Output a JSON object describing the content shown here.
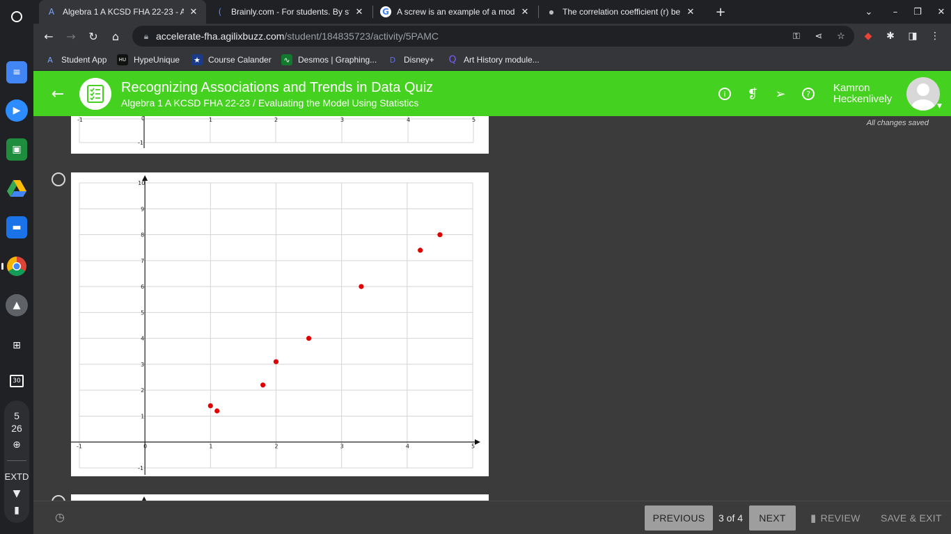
{
  "shelf": {
    "status_day": "5",
    "status_num": "26",
    "status_ext": "EXTD"
  },
  "tabs": [
    {
      "label": "Algebra 1 A KCSD FHA 22-23 - A"
    },
    {
      "label": "Brainly.com - For students. By st"
    },
    {
      "label": "A screw is an example of a mod"
    },
    {
      "label": "The correlation coefficient (r) bel"
    }
  ],
  "address": {
    "host": "accelerate-fha.agilixbuzz.com",
    "path": "/student/184835723/activity/5PAMC"
  },
  "bookmarks": [
    {
      "label": "Student App"
    },
    {
      "label": "HypeUnique"
    },
    {
      "label": "Course Calander"
    },
    {
      "label": "Desmos | Graphing..."
    },
    {
      "label": "Disney+"
    },
    {
      "label": "Art History module..."
    }
  ],
  "header": {
    "title": "Recognizing Associations and Trends in Data Quiz",
    "subtitle": "Algebra 1 A KCSD FHA 22-23 / Evaluating the Model Using Statistics",
    "user_first": "Kamron",
    "user_last": "Heckenlively"
  },
  "status": {
    "saved": "All changes saved"
  },
  "chart_data": [
    {
      "type": "scatter",
      "title": "",
      "xlim": [
        -1,
        5
      ],
      "ylim": [
        -1,
        10
      ],
      "x_ticks": [
        "-1",
        "0",
        "1",
        "2",
        "3",
        "4",
        "5"
      ],
      "y_ticks": [
        "-1",
        "1",
        "2",
        "3",
        "4",
        "5",
        "6",
        "7",
        "8",
        "9",
        "10"
      ],
      "points": [
        {
          "x": 1.0,
          "y": 1.4
        },
        {
          "x": 1.1,
          "y": 1.2
        },
        {
          "x": 1.8,
          "y": 2.2
        },
        {
          "x": 2.0,
          "y": 3.1
        },
        {
          "x": 2.5,
          "y": 4.0
        },
        {
          "x": 3.3,
          "y": 6.0
        },
        {
          "x": 4.2,
          "y": 7.4
        },
        {
          "x": 4.5,
          "y": 8.0
        }
      ],
      "point_color": "#e00000",
      "grid": true
    }
  ],
  "footer": {
    "previous": "PREVIOUS",
    "page": "3 of 4",
    "next": "NEXT",
    "review": "REVIEW",
    "save_exit": "SAVE & EXIT"
  },
  "colors": {
    "brand": "#45d11f",
    "panel": "#3b3b3c"
  }
}
